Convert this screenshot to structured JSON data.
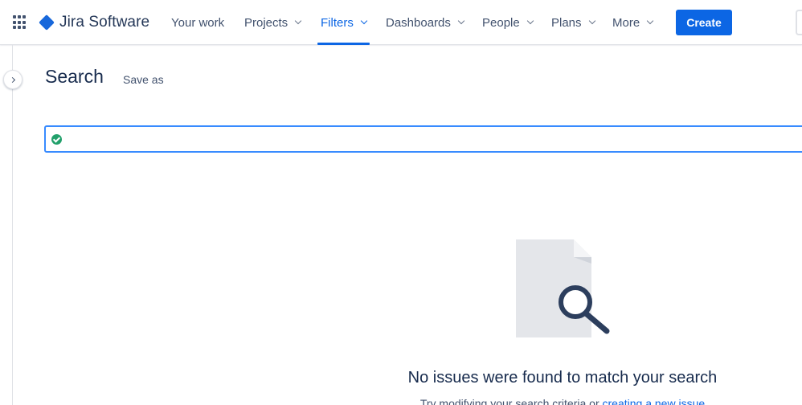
{
  "topnav": {
    "app_name": "Jira Software",
    "items": [
      {
        "label": "Your work",
        "dropdown": false
      },
      {
        "label": "Projects",
        "dropdown": true
      },
      {
        "label": "Filters",
        "dropdown": true,
        "active": true
      },
      {
        "label": "Dashboards",
        "dropdown": true
      },
      {
        "label": "People",
        "dropdown": true
      },
      {
        "label": "Plans",
        "dropdown": true
      },
      {
        "label": "More",
        "dropdown": true
      }
    ],
    "create_label": "Create",
    "accent_color": "#0c66e4"
  },
  "sidebar": {
    "expand_icon": "chevron-right-icon"
  },
  "header": {
    "title": "Search",
    "save_as_label": "Save as"
  },
  "jql": {
    "value": "",
    "status_icon": "check-circle-icon",
    "status_color": "#22a06b"
  },
  "empty_state": {
    "illustration": "document-magnifier-icon",
    "title": "No issues were found to match your search",
    "subtitle_prefix": "Try modifying your search criteria or ",
    "subtitle_link": "creating a new issue"
  }
}
